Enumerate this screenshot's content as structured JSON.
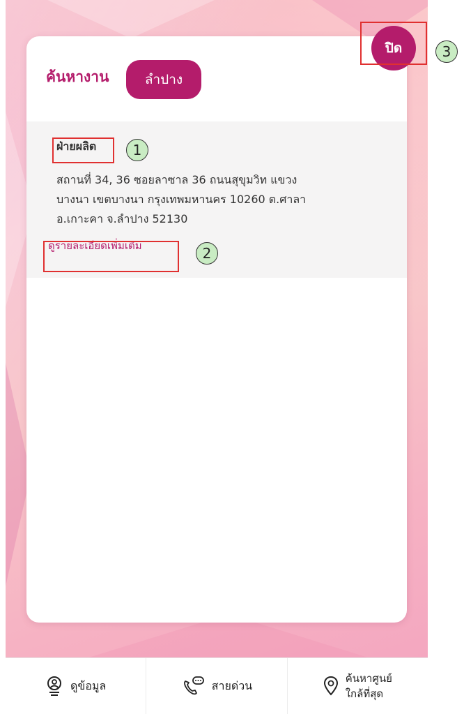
{
  "header": {
    "title": "ค้นหางาน",
    "province": "ลำปาง"
  },
  "close_button": {
    "label": "ปิด"
  },
  "result": {
    "title": "ฝ่ายผลิต",
    "address_lines": [
      "สถานที่ 34, 36 ซอยลาซาล 36 ถนนสุขุมวิท แขวง",
      "บางนา เขตบางนา กรุงเทพมหานคร 10260 ต.ศาลา",
      "อ.เกาะคา จ.ลำปาง 52130"
    ],
    "link": "ดูรายละเอียดเพิ่มเติม"
  },
  "annotations": {
    "one": "1",
    "two": "2",
    "three": "3"
  },
  "bottom_nav": {
    "info": {
      "label": "ดูข้อมูล",
      "icon": "user-info-icon"
    },
    "hotline": {
      "label": "สายด่วน",
      "icon": "phone-chat-icon"
    },
    "nearest": {
      "line1": "ค้นหาศูนย์",
      "line2": "ใกล้ที่สุด",
      "icon": "location-pin-icon"
    }
  },
  "colors": {
    "accent": "#b41c6b",
    "annotation_box": "#e03030",
    "annotation_circle": "#c9ecc3"
  }
}
